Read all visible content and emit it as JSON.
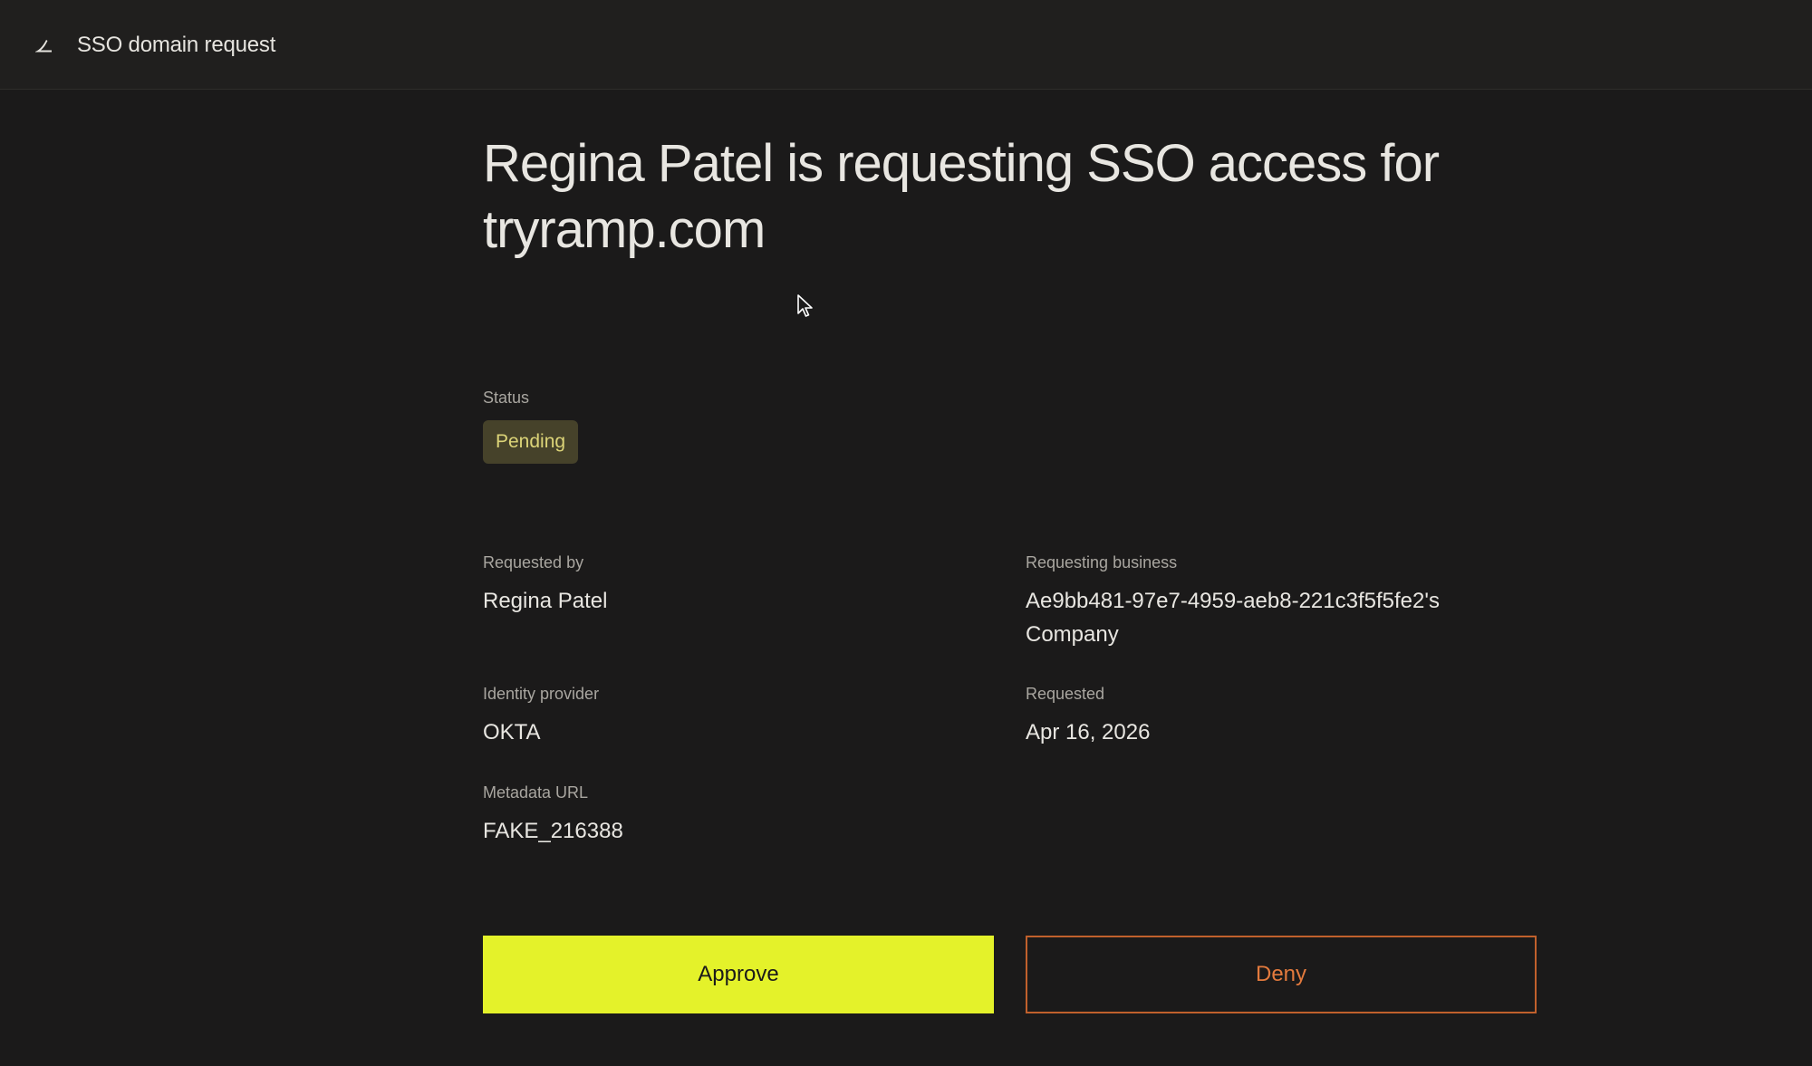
{
  "header": {
    "logo_icon": "ramp-logo-icon",
    "title": "SSO domain request"
  },
  "main": {
    "headline": "Regina Patel is requesting SSO access for tryramp.com",
    "status": {
      "label": "Status",
      "value": "Pending"
    },
    "details": {
      "requested_by": {
        "label": "Requested by",
        "value": "Regina Patel"
      },
      "requesting_business": {
        "label": "Requesting business",
        "value": "Ae9bb481-97e7-4959-aeb8-221c3f5f5fe2's Company"
      },
      "identity_provider": {
        "label": "Identity provider",
        "value": "OKTA"
      },
      "requested": {
        "label": "Requested",
        "value": "Apr 16, 2026"
      },
      "metadata_url": {
        "label": "Metadata URL",
        "value": "FAKE_216388"
      }
    },
    "actions": {
      "approve_label": "Approve",
      "deny_label": "Deny"
    }
  },
  "colors": {
    "background": "#1b1a1a",
    "approve": "#e4f22a",
    "deny": "#e37a3d",
    "pending_badge_bg": "#46422a",
    "pending_badge_text": "#dcd478"
  }
}
